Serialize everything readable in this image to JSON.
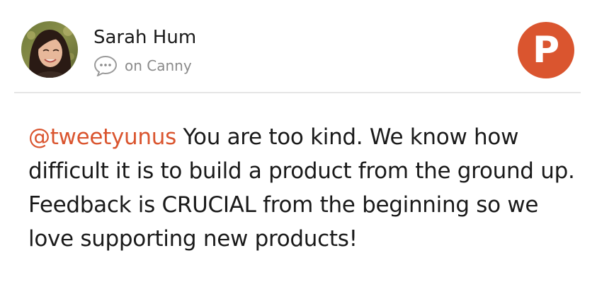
{
  "author": {
    "name": "Sarah Hum",
    "avatar_icon": "profile-photo"
  },
  "source": {
    "icon": "speech-bubble-icon",
    "text": "on Canny"
  },
  "brand": {
    "letter": "P",
    "color": "#da552f"
  },
  "post": {
    "mention": "@tweetyunus",
    "mention_color": "#da552f",
    "text": " You are too kind. We know how difficult it is to build a product from the ground up. Feedback is CRUCIAL from the beginning so we love supporting new products!"
  }
}
